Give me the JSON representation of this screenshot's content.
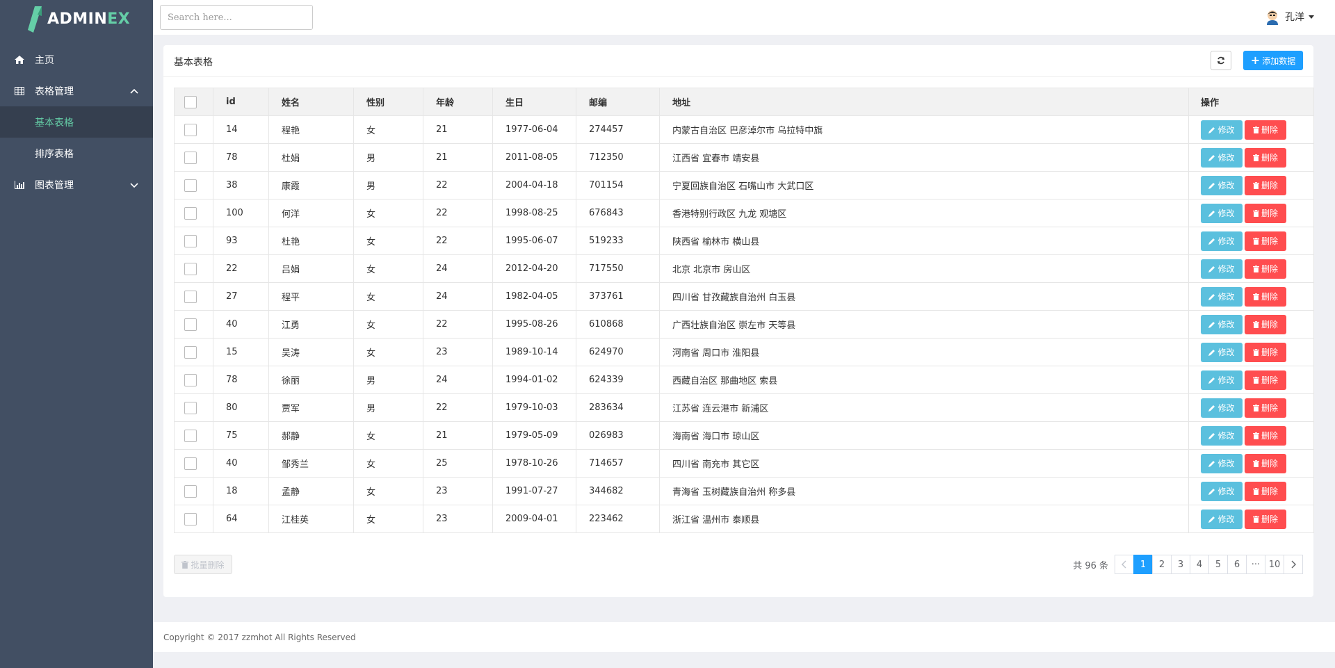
{
  "app": {
    "logo_main": "ADMIN",
    "logo_accent": "EX"
  },
  "sidebar": {
    "items": [
      {
        "label": "主页",
        "icon": "home-icon"
      },
      {
        "label": "表格管理",
        "icon": "table-icon",
        "expanded": true,
        "children": [
          {
            "label": "基本表格",
            "active": true
          },
          {
            "label": "排序表格"
          }
        ]
      },
      {
        "label": "图表管理",
        "icon": "bar-chart-icon",
        "expanded": false
      }
    ]
  },
  "header": {
    "search_placeholder": "Search here...",
    "user_name": "孔洋"
  },
  "panel": {
    "title": "基本表格",
    "add_label": "添加数据",
    "batch_delete_label": "批量删除"
  },
  "table": {
    "headers": [
      "id",
      "姓名",
      "性别",
      "年龄",
      "生日",
      "邮编",
      "地址",
      "操作"
    ],
    "edit_label": "修改",
    "delete_label": "删除",
    "rows": [
      [
        "14",
        "程艳",
        "女",
        "21",
        "1977-06-04",
        "274457",
        "内蒙古自治区 巴彦淖尔市 乌拉特中旗"
      ],
      [
        "78",
        "杜娟",
        "男",
        "21",
        "2011-08-05",
        "712350",
        "江西省 宜春市 靖安县"
      ],
      [
        "38",
        "康霞",
        "男",
        "22",
        "2004-04-18",
        "701154",
        "宁夏回族自治区 石嘴山市 大武口区"
      ],
      [
        "100",
        "何洋",
        "女",
        "22",
        "1998-08-25",
        "676843",
        "香港特别行政区 九龙 观塘区"
      ],
      [
        "93",
        "杜艳",
        "女",
        "22",
        "1995-06-07",
        "519233",
        "陕西省 榆林市 横山县"
      ],
      [
        "22",
        "吕娟",
        "女",
        "24",
        "2012-04-20",
        "717550",
        "北京 北京市 房山区"
      ],
      [
        "27",
        "程平",
        "女",
        "24",
        "1982-04-05",
        "373761",
        "四川省 甘孜藏族自治州 白玉县"
      ],
      [
        "40",
        "江勇",
        "女",
        "22",
        "1995-08-26",
        "610868",
        "广西壮族自治区 崇左市 天等县"
      ],
      [
        "15",
        "吴涛",
        "女",
        "23",
        "1989-10-14",
        "624970",
        "河南省 周口市 淮阳县"
      ],
      [
        "78",
        "徐丽",
        "男",
        "24",
        "1994-01-02",
        "624339",
        "西藏自治区 那曲地区 索县"
      ],
      [
        "80",
        "贾军",
        "男",
        "22",
        "1979-10-03",
        "283634",
        "江苏省 连云港市 新浦区"
      ],
      [
        "75",
        "郝静",
        "女",
        "21",
        "1979-05-09",
        "026983",
        "海南省 海口市 琼山区"
      ],
      [
        "40",
        "邹秀兰",
        "女",
        "25",
        "1978-10-26",
        "714657",
        "四川省 南充市 其它区"
      ],
      [
        "18",
        "孟静",
        "女",
        "23",
        "1991-07-27",
        "344682",
        "青海省 玉树藏族自治州 称多县"
      ],
      [
        "64",
        "江桂英",
        "女",
        "23",
        "2009-04-01",
        "223462",
        "浙江省 温州市 泰顺县"
      ]
    ]
  },
  "pagination": {
    "total_text": "共 96 条",
    "pages": [
      "1",
      "2",
      "3",
      "4",
      "5",
      "6",
      "···",
      "10"
    ],
    "current": "1"
  },
  "footer": {
    "copyright": "Copyright © 2017 zzmhot All Rights Reserved"
  },
  "colors": {
    "sidebar_bg": "#424f63",
    "accent_green": "#65cea7",
    "primary_blue": "#1e9fff",
    "edit_blue": "#5bc0de",
    "danger_red": "#ff4d4f"
  }
}
